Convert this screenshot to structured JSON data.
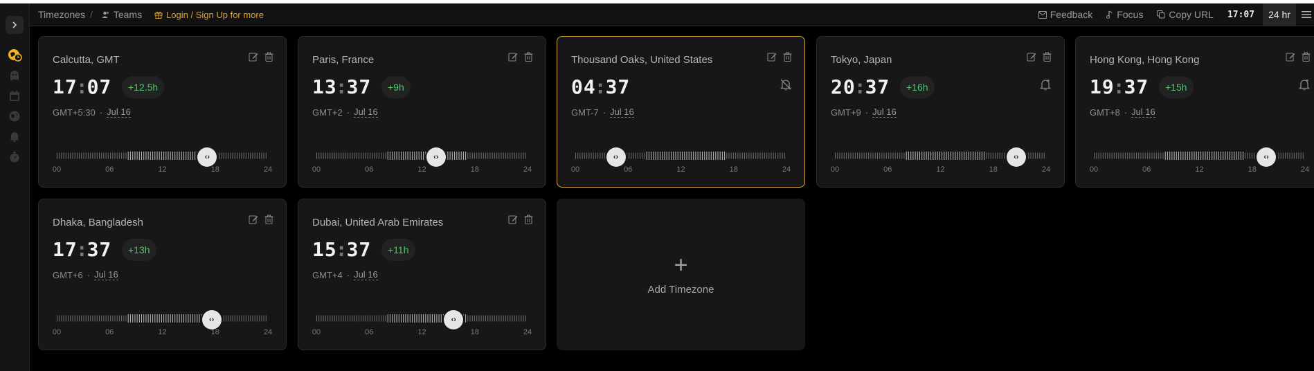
{
  "header": {
    "breadcrumb": "Timezones",
    "teams_label": "Teams",
    "login_label": "Login / Sign Up for more",
    "feedback_label": "Feedback",
    "focus_label": "Focus",
    "copy_url_label": "Copy URL",
    "current_time": "17:07",
    "format_toggle": "24 hr"
  },
  "sidebar": {
    "icons": [
      "globe-clock-icon",
      "ghost-icon",
      "calendar-icon",
      "world-icon",
      "bell-icon",
      "timer-icon"
    ]
  },
  "cards": [
    {
      "city": "Calcutta, GMT",
      "hour": "17",
      "minute": "07",
      "diff": "+12.5h",
      "offset": "GMT+5:30",
      "date": "Jul 16",
      "slider_hour": 17.1,
      "bell": "none",
      "active": false
    },
    {
      "city": "Paris, France",
      "hour": "13",
      "minute": "37",
      "diff": "+9h",
      "offset": "GMT+2",
      "date": "Jul 16",
      "slider_hour": 13.6,
      "bell": "none",
      "active": false
    },
    {
      "city": "Thousand Oaks, United States",
      "hour": "04",
      "minute": "37",
      "diff": "",
      "offset": "GMT-7",
      "date": "Jul 16",
      "slider_hour": 4.6,
      "bell": "off",
      "active": true
    },
    {
      "city": "Tokyo, Japan",
      "hour": "20",
      "minute": "37",
      "diff": "+16h",
      "offset": "GMT+9",
      "date": "Jul 16",
      "slider_hour": 20.6,
      "bell": "on",
      "active": false
    },
    {
      "city": "Hong Kong, Hong Kong",
      "hour": "19",
      "minute": "37",
      "diff": "+15h",
      "offset": "GMT+8",
      "date": "Jul 16",
      "slider_hour": 19.6,
      "bell": "on",
      "active": false
    },
    {
      "city": "Dhaka, Bangladesh",
      "hour": "17",
      "minute": "37",
      "diff": "+13h",
      "offset": "GMT+6",
      "date": "Jul 16",
      "slider_hour": 17.6,
      "bell": "none",
      "active": false
    },
    {
      "city": "Dubai, United Arab Emirates",
      "hour": "15",
      "minute": "37",
      "diff": "+11h",
      "offset": "GMT+4",
      "date": "Jul 16",
      "slider_hour": 15.6,
      "bell": "none",
      "active": false
    }
  ],
  "hour_labels": [
    "00",
    "06",
    "12",
    "18",
    "24"
  ],
  "add_card": {
    "label": "Add Timezone"
  },
  "colors": {
    "accent": "#e0a030",
    "active_border": "#d9a93a",
    "positive": "#54c46a"
  }
}
